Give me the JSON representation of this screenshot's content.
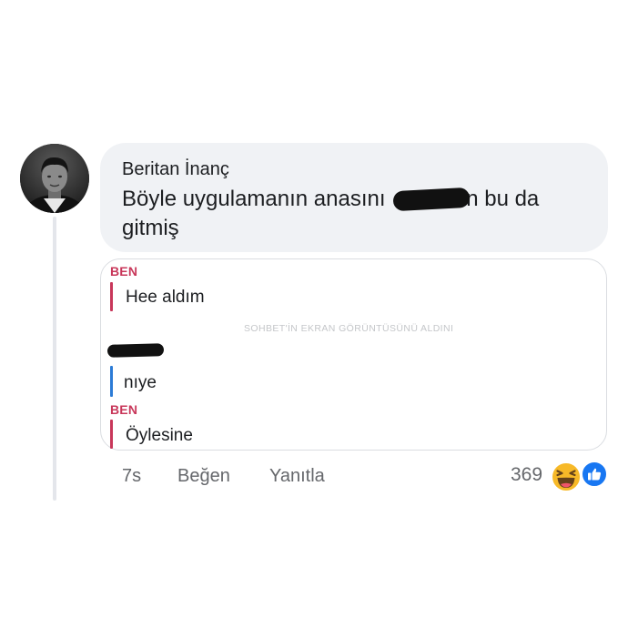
{
  "comment": {
    "author": "Beritan İnanç",
    "text_before": "Böyle uygulamanın anasını",
    "text_after": "n bu da gitmiş"
  },
  "chat_card": {
    "watermark": "SOHBET'İN EKRAN GÖRÜNTÜSÜNÜ ALDINI",
    "messages": [
      {
        "sender": "BEN",
        "text": "Hee aldım",
        "bar_color": "#c8375a"
      },
      {
        "sender": "",
        "text": "nıye",
        "bar_color": "#2b7bd6"
      },
      {
        "sender": "BEN",
        "text": "Öylesine",
        "bar_color": "#c8375a"
      }
    ]
  },
  "actions": {
    "time": "7s",
    "like": "Beğen",
    "reply": "Yanıtla",
    "reaction_count": "369"
  },
  "reactions": [
    "haha-icon",
    "like-icon"
  ],
  "colors": {
    "bubble": "#f0f2f5",
    "accent_red": "#c8375a",
    "accent_blue": "#2b7bd6",
    "like_blue": "#1877f2",
    "haha_yellow": "#f7b928"
  }
}
